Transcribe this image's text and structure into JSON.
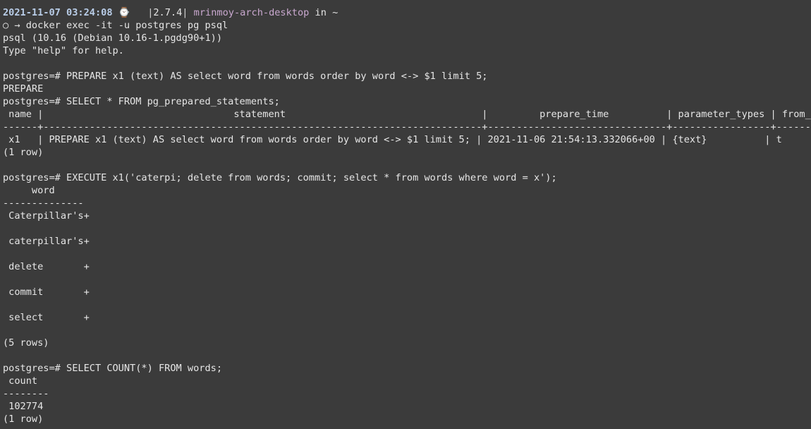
{
  "prompt": {
    "datetime": "2021-11-07 03:24:08",
    "icon": "watch-icon",
    "version_sep": "|",
    "version": "2.7.4",
    "version_sep_end": "|",
    "host": "mrinmoy-arch-desktop",
    "location": "in ~",
    "indicator": "○",
    "arrow": "→",
    "command": "docker exec -it -u postgres pg psql"
  },
  "lines": [
    "psql (10.16 (Debian 10.16-1.pgdg90+1))",
    "Type \"help\" for help.",
    "",
    "postgres=# PREPARE x1 (text) AS select word from words order by word <-> $1 limit 5;",
    "PREPARE",
    "postgres=# SELECT * FROM pg_prepared_statements;",
    " name |                                 statement                                  |         prepare_time          | parameter_types | from_sql",
    "------+----------------------------------------------------------------------------+-------------------------------+-----------------+----------",
    " x1   | PREPARE x1 (text) AS select word from words order by word <-> $1 limit 5; | 2021-11-06 21:54:13.332066+00 | {text}          | t",
    "(1 row)",
    "",
    "postgres=# EXECUTE x1('caterpi; delete from words; commit; select * from words where word = x');",
    "     word",
    "--------------",
    " Caterpillar's+",
    "",
    " caterpillar's+",
    "",
    " delete       +",
    "",
    " commit       +",
    "",
    " select       +",
    "",
    "(5 rows)",
    "",
    "postgres=# SELECT COUNT(*) FROM words;",
    " count",
    "--------",
    " 102774",
    "(1 row)"
  ]
}
